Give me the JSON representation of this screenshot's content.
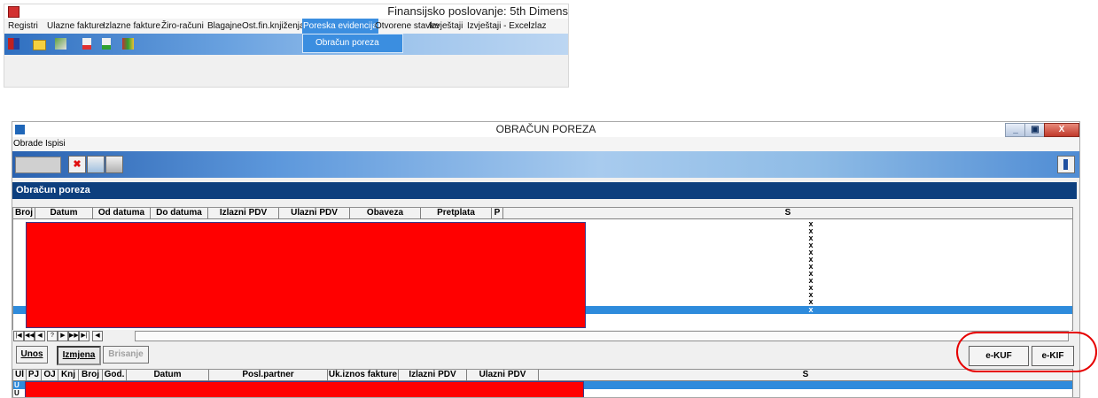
{
  "main_app": {
    "title": "Finansijsko poslovanje: 5th Dimens",
    "menu": [
      "Registri",
      "Ulazne fakture",
      "Izlazne fakture",
      "Žiro-računi",
      "Blagajne",
      "Ost.fin.knjiženja",
      "Poreska evidencija",
      "Otvorene stavke",
      "Izvještaji",
      "Izvještaji - Excel",
      "Izlaz"
    ],
    "active_menu": "Poreska evidencija",
    "dropdown_item": "Obračun poreza",
    "toolbar_icons": [
      "registry-icon",
      "folder-icon",
      "cards-icon",
      "document-down-icon",
      "document-up-icon",
      "books-icon"
    ]
  },
  "window": {
    "title": "OBRAČUN POREZA",
    "menu": [
      "Obrade",
      "Ispisi"
    ],
    "toolbar_buttons": [
      "cancel-icon",
      "edit-icon",
      "print-icon"
    ],
    "panel_title": "Obračun poreza",
    "grid1": {
      "columns": [
        "Broj",
        "Datum",
        "Od datuma",
        "Do datuma",
        "Izlazni PDV",
        "Ulazni PDV",
        "Obaveza",
        "Pretplata",
        "P",
        "S"
      ],
      "s_marks": [
        "x",
        "x",
        "x",
        "x",
        "x",
        "x",
        "x",
        "x",
        "x",
        "x",
        "x",
        "x"
      ],
      "selected_mark": "x"
    },
    "nav_buttons": [
      "|◀",
      "◀◀",
      "◀",
      "?",
      "▶",
      "▶▶",
      "▶|"
    ],
    "actions": {
      "unos": "Unos",
      "izmjena": "Izmjena",
      "brisanje": "Brisanje",
      "ekuf": "e-KUF",
      "ekif": "e-KIF"
    },
    "grid2": {
      "columns": [
        "Ul",
        "PJ",
        "OJ",
        "Knj",
        "Broj",
        "God.",
        "Datum",
        "Posl.partner",
        "Uk.iznos fakture",
        "Izlazni PDV",
        "Ulazni PDV",
        "S"
      ],
      "row_markers": [
        "U",
        "U"
      ]
    }
  },
  "colors": {
    "highlight": "#e60000",
    "selection": "#2e8bdc",
    "panel": "#0d3f7e",
    "redaction": "#ff0000"
  }
}
